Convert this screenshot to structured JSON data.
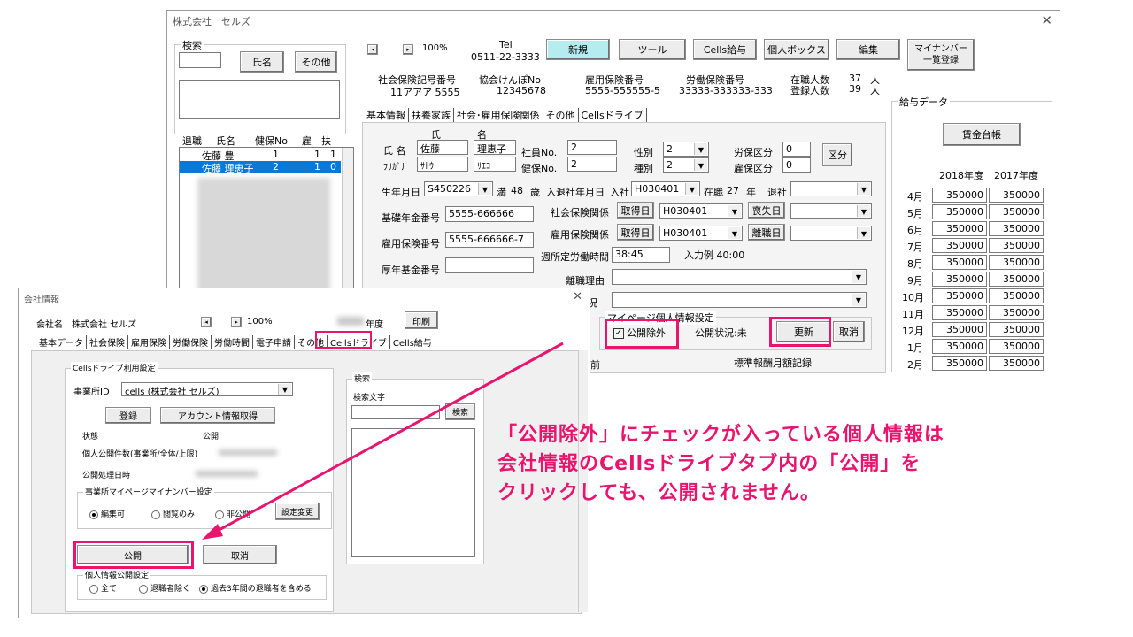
{
  "main_window": {
    "title": "株式会社　セルズ",
    "search_group": "検索",
    "name_button": "氏名",
    "other_button": "その他",
    "list_headers": [
      "退職",
      "氏名",
      "健保No",
      "雇",
      "扶"
    ],
    "list_rows": [
      {
        "name": "佐藤 豊",
        "no": "1",
        "koyo": "1",
        "fuyo": "1"
      },
      {
        "name": "佐藤 理恵子",
        "no": "2",
        "koyo": "1",
        "fuyo": "0"
      }
    ],
    "zoom": "100%",
    "tel_label": "Tel",
    "tel_value": "0511-22-3333",
    "toolbar": [
      "新規",
      "ツール",
      "Cells給与",
      "個人ボックス",
      "編集"
    ],
    "mynumber_button": "マイナンバー\n一覧登録",
    "ins_headers": [
      "社会保険記号番号",
      "協会けんぽNo",
      "雇用保険番号",
      "労働保険番号"
    ],
    "ins_values": [
      "11アアア 5555",
      "12345678",
      "5555-555555-5",
      "33333-333333-333"
    ],
    "zaishoku_label": "在職人数",
    "zaishoku_value": "37",
    "toroku_label": "登録人数",
    "toroku_value": "39",
    "person_unit": "人",
    "tabs": [
      "基本情報",
      "扶養家族",
      "社会･雇用保険関係",
      "その他",
      "Cellsドライブ"
    ],
    "form": {
      "shi": "氏",
      "mei": "名",
      "name_label": "氏 名",
      "last_name": "佐藤",
      "first_name": "理恵子",
      "kana_label": "ﾌﾘｶﾞﾅ",
      "last_kana": "ｻﾄｳ",
      "first_kana": "ﾘｴｺ",
      "shain_label": "社員No.",
      "shain_value": "2",
      "kenpo_label": "健保No.",
      "kenpo_value": "2",
      "seibetsu_label": "性別",
      "seibetsu_value": "2",
      "shubetsu_label": "種別",
      "shubetsu_value": "2",
      "rouho_label": "労保区分",
      "rouho_value": "0",
      "koyo_label": "雇保区分",
      "koyo_value": "0",
      "kubun_button": "区分",
      "birth_label": "生年月日",
      "birth_value": "S450226",
      "man": "満",
      "age": "48",
      "sai": "歳",
      "nyutai_label": "入退社年月日",
      "nyusha": "入社",
      "nyusha_value": "H030401",
      "zaishoku": "在職",
      "years": "27",
      "nen": "年",
      "taisha": "退社",
      "kiso_label": "基礎年金番号",
      "kiso_value": "5555-666666",
      "koyono_label": "雇用保険番号",
      "koyono_value": "5555-666666-7",
      "kosei_label": "厚年基金番号",
      "shaho_label": "社会保険関係",
      "koyoho_label": "雇用保険関係",
      "shutoku": "取得日",
      "shaho_date": "H030401",
      "koyo_date": "H030401",
      "soshitsu": "喪失日",
      "rishoku": "離職日",
      "shukan_label": "週所定労働時間",
      "shukan_value": "38:45",
      "nyuryoku": "入力例 40:00",
      "riyu_label": "離職理由",
      "jokyo_label": "状況",
      "mypage_group": "マイページ個人情報設定",
      "kokai_jogai": "公開除外",
      "kokai_status": "公開状況:未",
      "koshin_button": "更新",
      "cancel_button": "取消",
      "mae": "前",
      "hyojun": "標準報酬月額記録"
    },
    "salary": {
      "group": "給与データ",
      "ledger_button": "賃金台帳",
      "years": [
        "2018年度",
        "2017年度"
      ],
      "months": [
        "4月",
        "5月",
        "6月",
        "7月",
        "8月",
        "9月",
        "10月",
        "11月",
        "12月",
        "1月",
        "2月"
      ],
      "values_2018": [
        "350000",
        "350000",
        "350000",
        "350000",
        "350000",
        "350000",
        "350000",
        "350000",
        "350000",
        "350000",
        "350000"
      ],
      "values_2017": [
        "350000",
        "350000",
        "350000",
        "350000",
        "350000",
        "350000",
        "350000",
        "350000",
        "350000",
        "350000",
        "350000"
      ]
    }
  },
  "company_window": {
    "title": "会社情報",
    "company_label": "会社名",
    "company_name": "株式会社 セルズ",
    "zoom": "100%",
    "nendo": "年度",
    "print_button": "印刷",
    "tabs": [
      "基本データ",
      "社会保険",
      "雇用保険",
      "労働保険",
      "労働時間",
      "電子申請",
      "その他",
      "Cellsドライブ",
      "Cells給与"
    ],
    "drive_group": "Cellsドライブ利用設定",
    "office_label": "事業所ID",
    "office_value": "cells (株式会社 セルズ)",
    "register_button": "登録",
    "account_button": "アカウント情報取得",
    "status_label": "状態",
    "status_value": "公開",
    "count_label": "個人公開件数(事業所/全体/上限)",
    "date_label": "公開処理日時",
    "mynumber_group": "事業所マイページマイナンバー設定",
    "radio_edit": "編集可",
    "radio_view": "閲覧のみ",
    "radio_hide": "非公開",
    "change_button": "設定変更",
    "publish_button": "公開",
    "cancel_button": "取消",
    "personal_group": "個人情報公開設定",
    "radio_all": "全て",
    "radio_exclude": "退職者除く",
    "radio_past3": "過去3年間の退職者を含める",
    "search_group": "検索",
    "search_text_label": "検索文字",
    "search_button": "検索"
  },
  "annotation": {
    "line1": "「公開除外」にチェックが入っている個人情報は",
    "line2": "会社情報のCellsドライブタブ内の「公開」を",
    "line3": "クリックしても、公開されません。",
    "color": "#e8156f"
  }
}
